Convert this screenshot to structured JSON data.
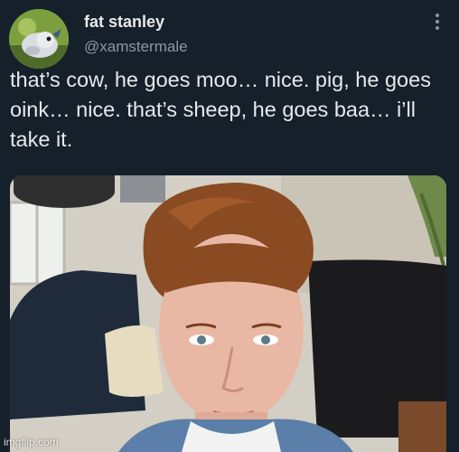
{
  "author": {
    "display_name": "fat stanley",
    "handle": "@xamstermale"
  },
  "tweet": {
    "text": "that’s cow, he goes moo… nice. pig, he goes oink… nice. that’s sheep, he goes baa… i’ll take it."
  },
  "icons": {
    "more": "more-options-icon"
  },
  "watermark": {
    "text": "imgflip.com"
  },
  "colors": {
    "background": "#15202b",
    "primary_text": "#e7e9ea",
    "secondary_text": "#8b98a5"
  }
}
